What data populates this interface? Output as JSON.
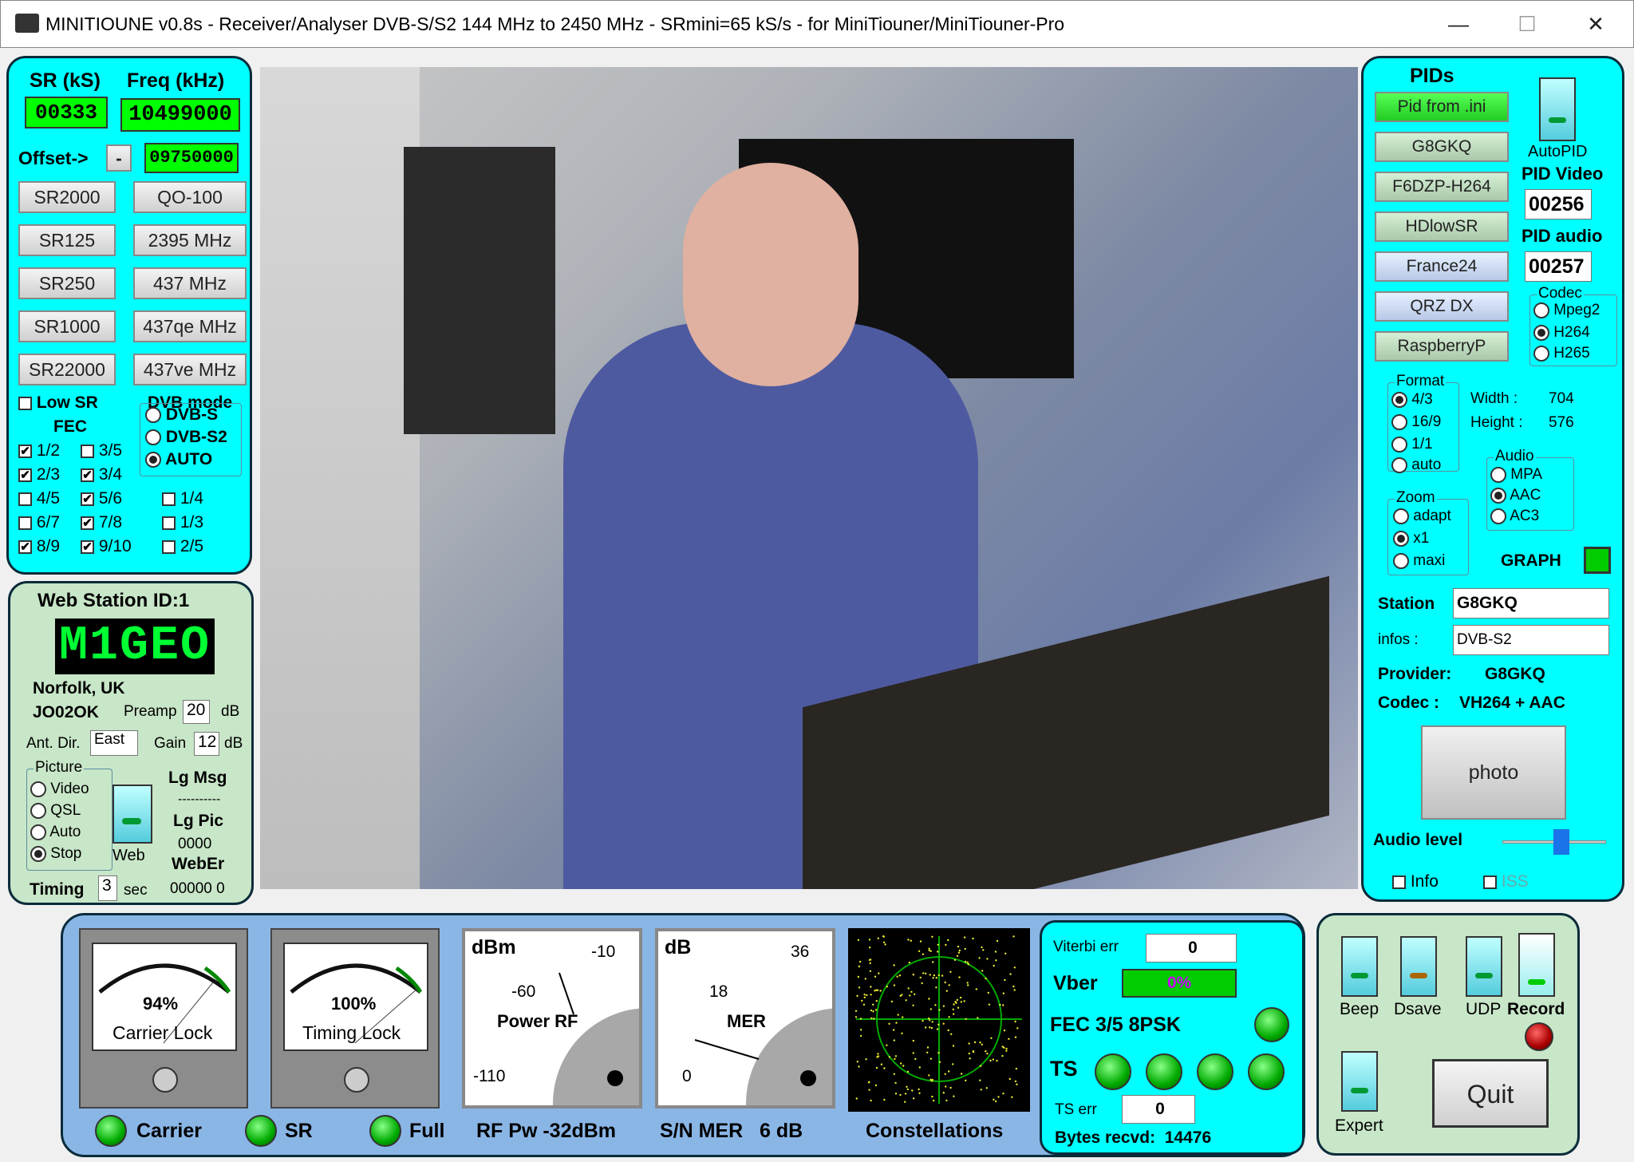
{
  "window": {
    "title": "MINITIOUNE v0.8s - Receiver/Analyser DVB-S/S2 144 MHz to 2450 MHz - SRmini=65 kS/s - for MiniTiouner/MiniTiouner-Pro"
  },
  "tuning": {
    "sr_label": "SR (kS)",
    "freq_label": "Freq (kHz)",
    "sr_value": "00333",
    "freq_value": "10499000",
    "offset_label": "Offset->",
    "offset_sign": "-",
    "offset_value": "09750000",
    "sr_buttons": [
      "SR2000",
      "SR125",
      "SR250",
      "SR1000",
      "SR22000"
    ],
    "freq_buttons": [
      "QO-100",
      "2395 MHz",
      "437 MHz",
      "437qe MHz",
      "437ve MHz"
    ],
    "low_sr": "Low SR",
    "fec_label": "FEC",
    "dvb_mode_label": "DVB mode",
    "dvb_modes": [
      "DVB-S",
      "DVB-S2",
      "AUTO"
    ],
    "fec": [
      {
        "l": "1/2",
        "c": "✔"
      },
      {
        "l": "3/5",
        "c": ""
      },
      {
        "l": "2/3",
        "c": "✔"
      },
      {
        "l": "3/4",
        "c": "✔"
      },
      {
        "l": "4/5",
        "c": ""
      },
      {
        "l": "5/6",
        "c": "✔"
      },
      {
        "l": "6/7",
        "c": ""
      },
      {
        "l": "7/8",
        "c": "✔"
      },
      {
        "l": "8/9",
        "c": "✔"
      },
      {
        "l": "9/10",
        "c": "✔"
      }
    ],
    "fec_extra": [
      "1/4",
      "1/3",
      "2/5"
    ]
  },
  "web": {
    "title": "Web Station ID:1",
    "callsign": "M1GEO",
    "location": "Norfolk, UK",
    "locator": "JO02OK",
    "preamp_label": "Preamp",
    "preamp_value": "20",
    "db": "dB",
    "antdir_label": "Ant. Dir.",
    "antdir_value": "East",
    "gain_label": "Gain",
    "gain_value": "12",
    "picture_label": "Picture",
    "picture_options": [
      "Video",
      "QSL",
      "Auto",
      "Stop"
    ],
    "web_label": "Web",
    "lgmsg": "Lg Msg",
    "dashes": "----------",
    "lgpic": "Lg Pic",
    "lgpic_value": "0000",
    "weber": "WebEr",
    "weber_value": "00000  0",
    "timing_label": "Timing",
    "timing_value": "3",
    "sec": "sec"
  },
  "pids": {
    "title": "PIDs",
    "buttons": [
      "Pid from .ini",
      "G8GKQ",
      "F6DZP-H264",
      "HDlowSR",
      "France24",
      "QRZ DX",
      "RaspberryP"
    ],
    "autopid": "AutoPID",
    "pid_video_label": "PID Video",
    "pid_video": "00256",
    "pid_audio_label": "PID audio",
    "pid_audio": "00257",
    "codec_label": "Codec",
    "codecs": [
      "Mpeg2",
      "H264",
      "H265"
    ],
    "format_label": "Format",
    "formats": [
      "4/3",
      "16/9",
      "1/1",
      "auto"
    ],
    "width_label": "Width :",
    "width": "704",
    "height_label": "Height :",
    "height": "576",
    "audio_label": "Audio",
    "audios": [
      "MPA",
      "AAC",
      "AC3"
    ],
    "zoom_label": "Zoom",
    "zooms": [
      "adapt",
      "x1",
      "maxi"
    ],
    "graph": "GRAPH",
    "station_label": "Station",
    "station": "G8GKQ",
    "infos_label": "infos :",
    "infos": "DVB-S2",
    "provider_label": "Provider:",
    "provider": "G8GKQ",
    "codec_info_label": "Codec :",
    "codec_info": "VH264 + AAC",
    "photo": "photo",
    "audio_level": "Audio level",
    "info": "Info",
    "iss": "ISS"
  },
  "meters": {
    "carrier_pct": "94%",
    "carrier_label": "Carrier Lock",
    "timing_pct": "100%",
    "timing_label": "Timing Lock",
    "power_unit": "dBm",
    "power_title": "Power RF",
    "p_ticks": [
      "-10",
      "-60",
      "-110"
    ],
    "mer_unit": "dB",
    "mer_title": "MER",
    "m_ticks": [
      "36",
      "18",
      "0"
    ],
    "carrier": "Carrier",
    "sr": "SR",
    "full": "Full",
    "rfpw": "RF Pw -32dBm",
    "snmer": "S/N MER   6 dB",
    "constellations": "Constellations"
  },
  "status": {
    "viterbi_label": "Viterbi err",
    "viterbi": "0",
    "vber_label": "Vber",
    "vber": "0%",
    "fec": "FEC 3/5 8PSK",
    "ts": "TS",
    "ts_err_label": "TS err",
    "ts_err": "0",
    "bytes": "Bytes recvd:  14476"
  },
  "controls": {
    "beep": "Beep",
    "dsave": "Dsave",
    "udp": "UDP",
    "record": "Record",
    "expert": "Expert",
    "quit": "Quit"
  }
}
